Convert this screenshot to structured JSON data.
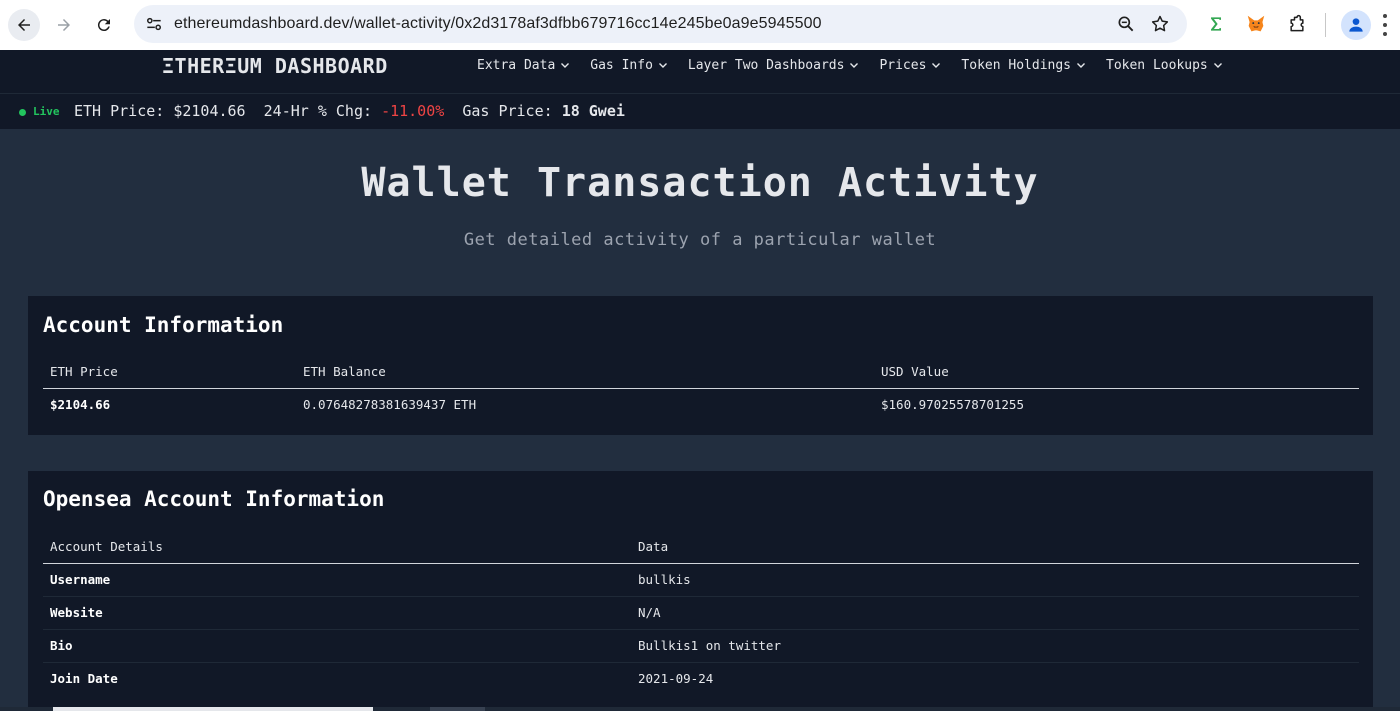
{
  "browser": {
    "url": "ethereumdashboard.dev/wallet-activity/0x2d3178af3dfbb679716cc14e245be0a9e5945500"
  },
  "site": {
    "brand": "ΞTHERΞUM DASHBOARD",
    "menu": [
      {
        "label": "Extra Data"
      },
      {
        "label": "Gas Info"
      },
      {
        "label": "Layer Two Dashboards"
      },
      {
        "label": "Prices"
      },
      {
        "label": "Token Holdings"
      },
      {
        "label": "Token Lookups"
      }
    ]
  },
  "ticker": {
    "live": "Live",
    "eth_price_label": "ETH Price:",
    "eth_price_value": "$2104.66",
    "change_label": "24-Hr % Chg:",
    "change_value": "-11.00%",
    "gas_label": "Gas Price:",
    "gas_value": "18 Gwei",
    "live_color": "#22c55e",
    "negative_color": "#ef4444"
  },
  "hero": {
    "title": "Wallet Transaction Activity",
    "subtitle": "Get detailed activity of a particular wallet"
  },
  "account": {
    "title": "Account Information",
    "headers": [
      "ETH Price",
      "ETH Balance",
      "USD Value"
    ],
    "row": [
      "$2104.66",
      "0.07648278381639437 ETH",
      "$160.97025578701255"
    ]
  },
  "opensea": {
    "title": "Opensea Account Information",
    "headers": [
      "Account Details",
      "Data"
    ],
    "rows": [
      [
        "Username",
        "bullkis"
      ],
      [
        "Website",
        "N/A"
      ],
      [
        "Bio",
        "Bullkis1 on twitter"
      ],
      [
        "Join Date",
        "2021-09-24"
      ]
    ]
  }
}
